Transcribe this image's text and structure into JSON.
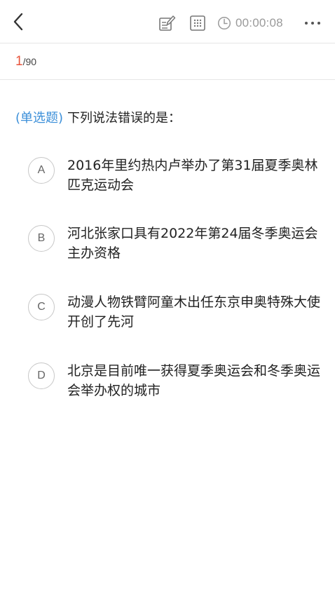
{
  "header": {
    "back_icon": "chevron-left-icon",
    "edit_icon": "edit-note-icon",
    "grid_icon": "answer-card-grid-icon",
    "timer_icon": "clock-icon",
    "timer": "00:00:08",
    "more_icon": "more-dots-icon",
    "muted_color": "#9a9a9a"
  },
  "progress": {
    "current": "1",
    "separator": "/",
    "total": "90",
    "current_color": "#e8543c"
  },
  "question": {
    "type_label": "(单选题)",
    "text": "下列说法错误的是：",
    "type_color": "#3b8fd9"
  },
  "options": [
    {
      "letter": "A",
      "text": "2016年里约热内卢举办了第31届夏季奥林匹克运动会"
    },
    {
      "letter": "B",
      "text": "河北张家口具有2022年第24届冬季奥运会主办资格"
    },
    {
      "letter": "C",
      "text": "动漫人物铁臂阿童木出任东京申奥特殊大使开创了先河"
    },
    {
      "letter": "D",
      "text": "北京是目前唯一获得夏季奥运会和冬季奥运会举办权的城市"
    }
  ]
}
